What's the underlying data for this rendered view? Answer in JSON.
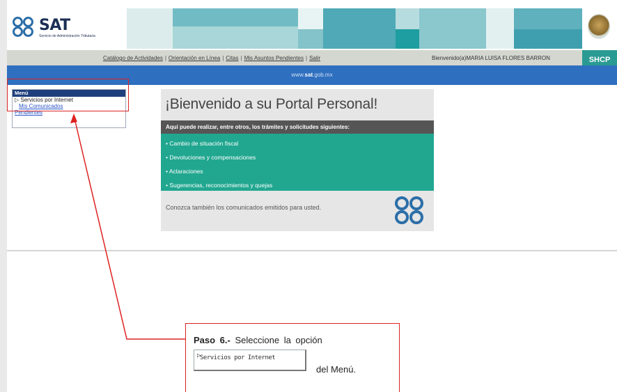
{
  "logo": {
    "brand": "SAT",
    "subtitle": "Servicio de Administración Tributaria"
  },
  "nav": {
    "links": [
      "Catálogo de Actividades",
      "Orientación en Línea",
      "Citas",
      "Mis Asuntos Pendientes",
      "Salir"
    ],
    "welcome": "Bienvenido(a)MARIA LUISA FLORES BARRON",
    "shcp": "SHCP"
  },
  "site_url": {
    "prefix": "www.",
    "bold": "sat",
    "suffix": ".gob.mx"
  },
  "menu": {
    "title": "Menú",
    "items": [
      "Servicios por Internet",
      "Mis Comunicados",
      "Pendientes"
    ]
  },
  "portal": {
    "title": "¡Bienvenido a su Portal Personal!",
    "subtitle": "Aquí puede realizar, entre otros, los trámites y solicitudes siguientes:",
    "items": [
      "Cambio de situación fiscal",
      "Devoluciones y compensaciones",
      "Aclaraciones",
      "Sugerencias, reconocimientos y quejas"
    ],
    "footer": "Conozca también los comunicados emitidos para usted."
  },
  "callout": {
    "step": "Paso 6.-",
    "instruction": "Seleccione la opción",
    "button_label": "Servicios por Internet",
    "suffix": "del Menú."
  },
  "colors": {
    "header_blue": "#2f6fbf",
    "teal": "#21a790",
    "menu_title": "#1e3f7c",
    "annotation_red": "#dd2222"
  }
}
